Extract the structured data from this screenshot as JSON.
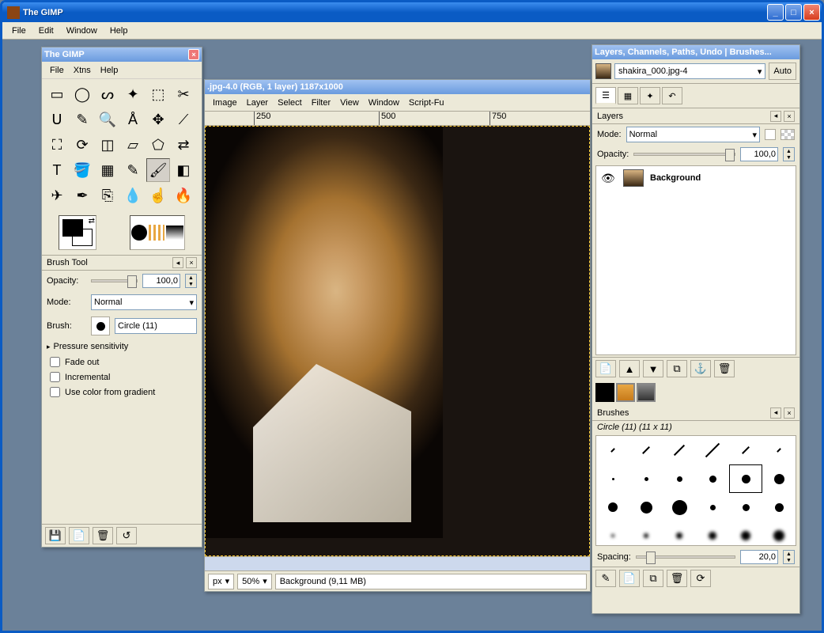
{
  "main_window": {
    "title": "The GIMP",
    "menu": [
      "File",
      "Edit",
      "Window",
      "Help"
    ]
  },
  "toolbox": {
    "title": "The GIMP",
    "menu": [
      "File",
      "Xtns",
      "Help"
    ],
    "tools": [
      "rect-select",
      "ellipse-select",
      "free-select",
      "fuzzy-select",
      "by-color-select",
      "scissors",
      "paths",
      "color-picker",
      "magnify",
      "measure",
      "move",
      "align",
      "crop",
      "rotate",
      "scale",
      "shear",
      "perspective",
      "flip",
      "text",
      "bucket-fill",
      "blend",
      "pencil",
      "paintbrush",
      "eraser",
      "airbrush",
      "ink",
      "clone",
      "blur",
      "smudge",
      "dodge"
    ],
    "tools_glyph": [
      "▭",
      "◯",
      "ᔕ",
      "✦",
      "⬚",
      "✂",
      "ᑌ",
      "✎",
      "🔍",
      "Å",
      "✥",
      "⟋",
      "⛶",
      "⟳",
      "◫",
      "▱",
      "⬠",
      "⇄",
      "T",
      "🪣",
      "▦",
      "✎",
      "🖌",
      "◧",
      "✈",
      "✒",
      "⎘",
      "💧",
      "☝",
      "🔥"
    ],
    "selected_tool": "paintbrush"
  },
  "brush_dock": {
    "title": "Brush Tool",
    "opacity_label": "Opacity:",
    "opacity_value": "100,0",
    "mode_label": "Mode:",
    "mode_value": "Normal",
    "brush_label": "Brush:",
    "brush_name": "Circle (11)",
    "pressure_label": "Pressure sensitivity",
    "fade_label": "Fade out",
    "incremental_label": "Incremental",
    "gradient_label": "Use color from gradient"
  },
  "image_window": {
    "title": ".jpg-4.0 (RGB, 1 layer) 1187x1000",
    "menu": [
      "Image",
      "Layer",
      "Select",
      "Filter",
      "View",
      "Window",
      "Script-Fu"
    ],
    "ruler_ticks": [
      "250",
      "500",
      "750"
    ],
    "unit": "px",
    "zoom": "50%",
    "status": "Background (9,11 MB)"
  },
  "right_dock": {
    "title": "Layers, Channels, Paths, Undo | Brushes...",
    "image_name": "shakira_000.jpg-4",
    "auto_label": "Auto",
    "layers_tab_label": "Layers",
    "mode_label": "Mode:",
    "mode_value": "Normal",
    "opacity_label": "Opacity:",
    "opacity_value": "100,0",
    "layers": [
      {
        "visible": true,
        "name": "Background"
      }
    ],
    "brushes_tab_label": "Brushes",
    "current_brush": "Circle (11) (11 x 11)",
    "spacing_label": "Spacing:",
    "spacing_value": "20,0",
    "brush_sizes": [
      [
        1,
        2,
        3,
        4,
        2,
        1
      ],
      [
        3,
        5,
        7,
        9,
        11,
        13
      ],
      [
        12,
        15,
        19,
        7,
        9,
        11
      ],
      [
        4,
        6,
        8,
        10,
        12,
        14
      ]
    ]
  }
}
